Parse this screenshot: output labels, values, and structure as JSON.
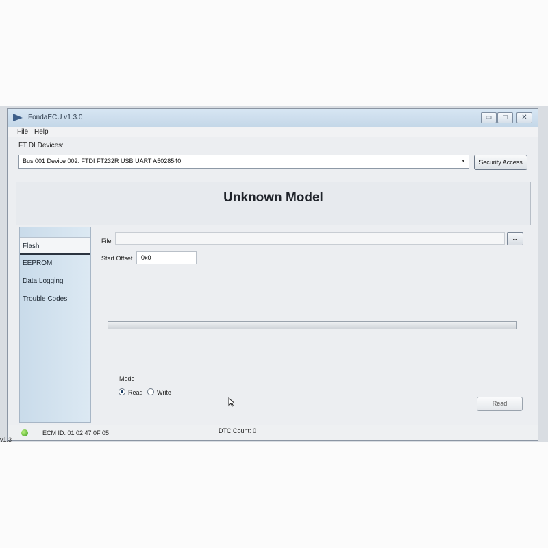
{
  "window": {
    "title": "FondaECU v1.3.0",
    "controls": {
      "minimize": "▭",
      "maximize": "□",
      "close": "✕"
    }
  },
  "menu": {
    "file": "File",
    "help": "Help"
  },
  "devices": {
    "label": "FT DI Devices:",
    "selected": "Bus 001 Device 002: FTDI FT232R USB UART A5028540",
    "security_button": "Security Access"
  },
  "model": {
    "title": "Unknown Model"
  },
  "nav": {
    "items": [
      {
        "label": "Flash"
      },
      {
        "label": "EEPROM"
      },
      {
        "label": "Data Logging"
      },
      {
        "label": "Trouble Codes"
      }
    ]
  },
  "flash": {
    "file_label": "File",
    "file_value": "",
    "browse_label": "...",
    "offset_label": "Start Offset",
    "offset_value": "0x0",
    "progress": 0.0,
    "mode_label": "Mode",
    "mode_options": [
      "Read",
      "Write"
    ],
    "mode_selected": "Read",
    "action_button": "Read"
  },
  "status": {
    "ecm_id": "ECM ID: 01 02 47 0F 05",
    "dtc_count": "DTC Count: 0",
    "indicator_color": "#3a9a1d"
  },
  "edge_text": "v1.3"
}
